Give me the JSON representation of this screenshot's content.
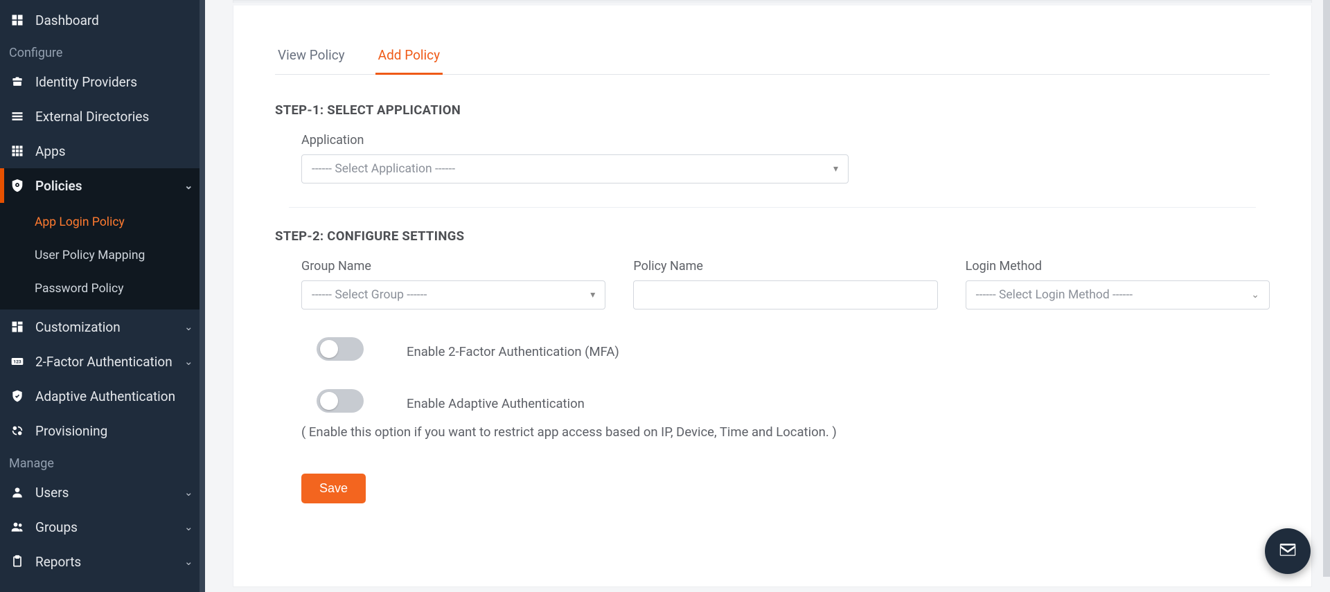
{
  "sidebar": {
    "dashboard": "Dashboard",
    "section_configure": "Configure",
    "identity_providers": "Identity Providers",
    "external_directories": "External Directories",
    "apps": "Apps",
    "policies": "Policies",
    "sub_app_login_policy": "App Login Policy",
    "sub_user_policy_mapping": "User Policy Mapping",
    "sub_password_policy": "Password Policy",
    "customization": "Customization",
    "two_factor": "2-Factor Authentication",
    "adaptive_auth": "Adaptive Authentication",
    "provisioning": "Provisioning",
    "section_manage": "Manage",
    "users": "Users",
    "groups": "Groups",
    "reports": "Reports"
  },
  "tabs": {
    "view": "View Policy",
    "add": "Add Policy"
  },
  "steps": {
    "step1": "STEP-1: SELECT APPLICATION",
    "step2": "STEP-2: CONFIGURE SETTINGS"
  },
  "fields": {
    "application_label": "Application",
    "application_placeholder": "------ Select Application ------",
    "group_label": "Group Name",
    "group_placeholder": "------ Select Group ------",
    "policy_label": "Policy Name",
    "policy_value": "",
    "login_method_label": "Login Method",
    "login_method_placeholder": "------ Select Login Method ------"
  },
  "toggles": {
    "mfa_label": "Enable 2-Factor Authentication (MFA)",
    "adaptive_label": "Enable Adaptive Authentication",
    "adaptive_note": "( Enable this option if you want to restrict app access based on IP, Device, Time and Location. )"
  },
  "buttons": {
    "save": "Save"
  }
}
